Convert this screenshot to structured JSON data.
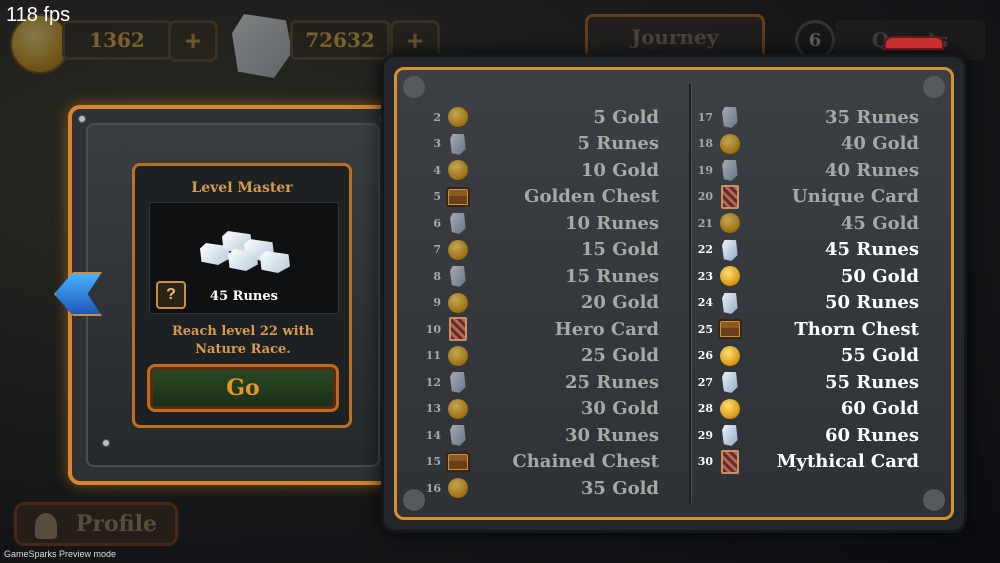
{
  "overlay": {
    "fps": "118 fps",
    "preview": "GameSparks Preview mode"
  },
  "topbar": {
    "gold_amount": "1362",
    "runes_amount": "72632",
    "plus_label": "+",
    "journey_label": "Journey",
    "quest_count": "6",
    "quests_label": "Quests"
  },
  "quest": {
    "title": "Level Master",
    "reward_label": "45 Runes",
    "mystery_symbol": "?",
    "description": "Reach level 22 with Nature Race.",
    "go_label": "Go"
  },
  "profile": {
    "label": "Profile"
  },
  "rewards": {
    "left": [
      {
        "level": "2",
        "icon": "gold-coin-icon",
        "text": "5 Gold",
        "state": "dim"
      },
      {
        "level": "3",
        "icon": "rune-icon",
        "text": "5 Runes",
        "state": "dim"
      },
      {
        "level": "4",
        "icon": "gold-coin-icon",
        "text": "10 Gold",
        "state": "dim"
      },
      {
        "level": "5",
        "icon": "chest-icon",
        "text": "Golden Chest",
        "state": "dim"
      },
      {
        "level": "6",
        "icon": "rune-icon",
        "text": "10 Runes",
        "state": "dim"
      },
      {
        "level": "7",
        "icon": "gold-coin-icon",
        "text": "15 Gold",
        "state": "dim"
      },
      {
        "level": "8",
        "icon": "rune-icon",
        "text": "15 Runes",
        "state": "dim"
      },
      {
        "level": "9",
        "icon": "gold-coin-icon",
        "text": "20 Gold",
        "state": "dim"
      },
      {
        "level": "10",
        "icon": "card-icon",
        "text": "Hero Card",
        "state": "dim"
      },
      {
        "level": "11",
        "icon": "gold-coin-icon",
        "text": "25 Gold",
        "state": "dim"
      },
      {
        "level": "12",
        "icon": "rune-icon",
        "text": "25 Runes",
        "state": "dim"
      },
      {
        "level": "13",
        "icon": "gold-coin-icon",
        "text": "30 Gold",
        "state": "dim"
      },
      {
        "level": "14",
        "icon": "rune-icon",
        "text": "30 Runes",
        "state": "dim"
      },
      {
        "level": "15",
        "icon": "chest-icon",
        "text": "Chained Chest",
        "state": "dim"
      },
      {
        "level": "16",
        "icon": "gold-coin-icon",
        "text": "35 Gold",
        "state": "dim"
      }
    ],
    "right": [
      {
        "level": "17",
        "icon": "rune-icon",
        "text": "35 Runes",
        "state": "dim"
      },
      {
        "level": "18",
        "icon": "gold-coin-icon",
        "text": "40 Gold",
        "state": "dim"
      },
      {
        "level": "19",
        "icon": "rune-icon",
        "text": "40 Runes",
        "state": "dim"
      },
      {
        "level": "20",
        "icon": "card-icon",
        "text": "Unique Card",
        "state": "dim"
      },
      {
        "level": "21",
        "icon": "gold-coin-icon",
        "text": "45 Gold",
        "state": "dim"
      },
      {
        "level": "22",
        "icon": "rune-icon",
        "text": "45 Runes",
        "state": "lit"
      },
      {
        "level": "23",
        "icon": "gold-coin-icon",
        "text": "50 Gold",
        "state": "lit"
      },
      {
        "level": "24",
        "icon": "rune-icon",
        "text": "50 Runes",
        "state": "lit"
      },
      {
        "level": "25",
        "icon": "chest-icon",
        "text": "Thorn Chest",
        "state": "lit"
      },
      {
        "level": "26",
        "icon": "gold-coin-icon",
        "text": "55 Gold",
        "state": "lit"
      },
      {
        "level": "27",
        "icon": "rune-icon",
        "text": "55 Runes",
        "state": "lit"
      },
      {
        "level": "28",
        "icon": "gold-coin-icon",
        "text": "60 Gold",
        "state": "lit"
      },
      {
        "level": "29",
        "icon": "rune-icon",
        "text": "60 Runes",
        "state": "lit"
      },
      {
        "level": "30",
        "icon": "card-icon",
        "text": "Mythical Card",
        "state": "lit"
      }
    ]
  },
  "colors": {
    "accent_orange": "#d89030",
    "text_lit": "#ffffff",
    "text_dim": "#a8a8a4",
    "quest_gold": "#d89a4a"
  }
}
